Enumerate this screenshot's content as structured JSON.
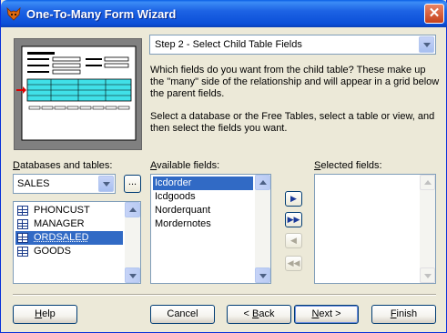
{
  "window": {
    "title": "One-To-Many Form Wizard",
    "close_glyph": "✕"
  },
  "step": {
    "selected": "Step 2 - Select Child Table Fields"
  },
  "description": {
    "p1": "Which fields do you want from the child table? These make up the \"many\" side of the relationship and will appear in a grid below the parent fields.",
    "p2": "Select a database or the Free Tables, select a table or view, and then select the fields you want."
  },
  "databases": {
    "label_prefix": "D",
    "label_rest": "atabases and tables:",
    "selected": "SALES",
    "browse_label": "...",
    "tables": [
      {
        "name": "PHONCUST",
        "selected": false
      },
      {
        "name": "MANAGER",
        "selected": false
      },
      {
        "name": "ORDSALED",
        "selected": true
      },
      {
        "name": "GOODS",
        "selected": false
      }
    ]
  },
  "available": {
    "label_prefix": "A",
    "label_rest": "vailable fields:",
    "fields": [
      {
        "name": "Icdorder",
        "selected": true
      },
      {
        "name": "Icdgoods",
        "selected": false
      },
      {
        "name": "Norderquant",
        "selected": false
      },
      {
        "name": "Mordernotes",
        "selected": false
      }
    ]
  },
  "selected_fields": {
    "label_prefix": "S",
    "label_rest": "elected fields:",
    "fields": []
  },
  "move_buttons": {
    "add": "▶",
    "add_all": "▶▶",
    "remove": "◀",
    "remove_all": "◀◀"
  },
  "buttons": {
    "help": {
      "prefix": "H",
      "rest": "elp"
    },
    "cancel": "Cancel",
    "back": {
      "pre": "< ",
      "u": "B",
      "rest": "ack"
    },
    "next": {
      "u": "N",
      "rest": "ext >"
    },
    "finish": {
      "u": "F",
      "rest": "inish"
    }
  },
  "colors": {
    "titlebar": "#0b4fd8",
    "selection": "#316ac5",
    "dialog_bg": "#ece9d8"
  }
}
